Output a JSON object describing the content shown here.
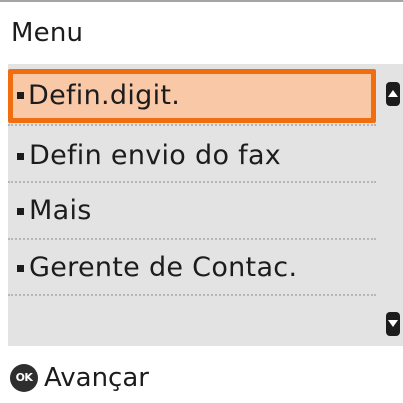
{
  "header": {
    "title": "Menu"
  },
  "menu": {
    "items": [
      {
        "label": "Defin.digit.",
        "selected": true
      },
      {
        "label": "Defin envio do fax",
        "selected": false
      },
      {
        "label": "Mais",
        "selected": false
      },
      {
        "label": "Gerente de Contac.",
        "selected": false
      }
    ]
  },
  "scrollbar": {
    "up_icon": "scroll-up-arrow",
    "down_icon": "scroll-down-arrow"
  },
  "footer": {
    "ok_icon_text": "OK",
    "action_label": "Avançar"
  },
  "colors": {
    "selection_border": "#f06d10",
    "selection_fill": "#f9c8a6",
    "list_background": "#e3e3e3",
    "text": "#1c1c1c"
  }
}
